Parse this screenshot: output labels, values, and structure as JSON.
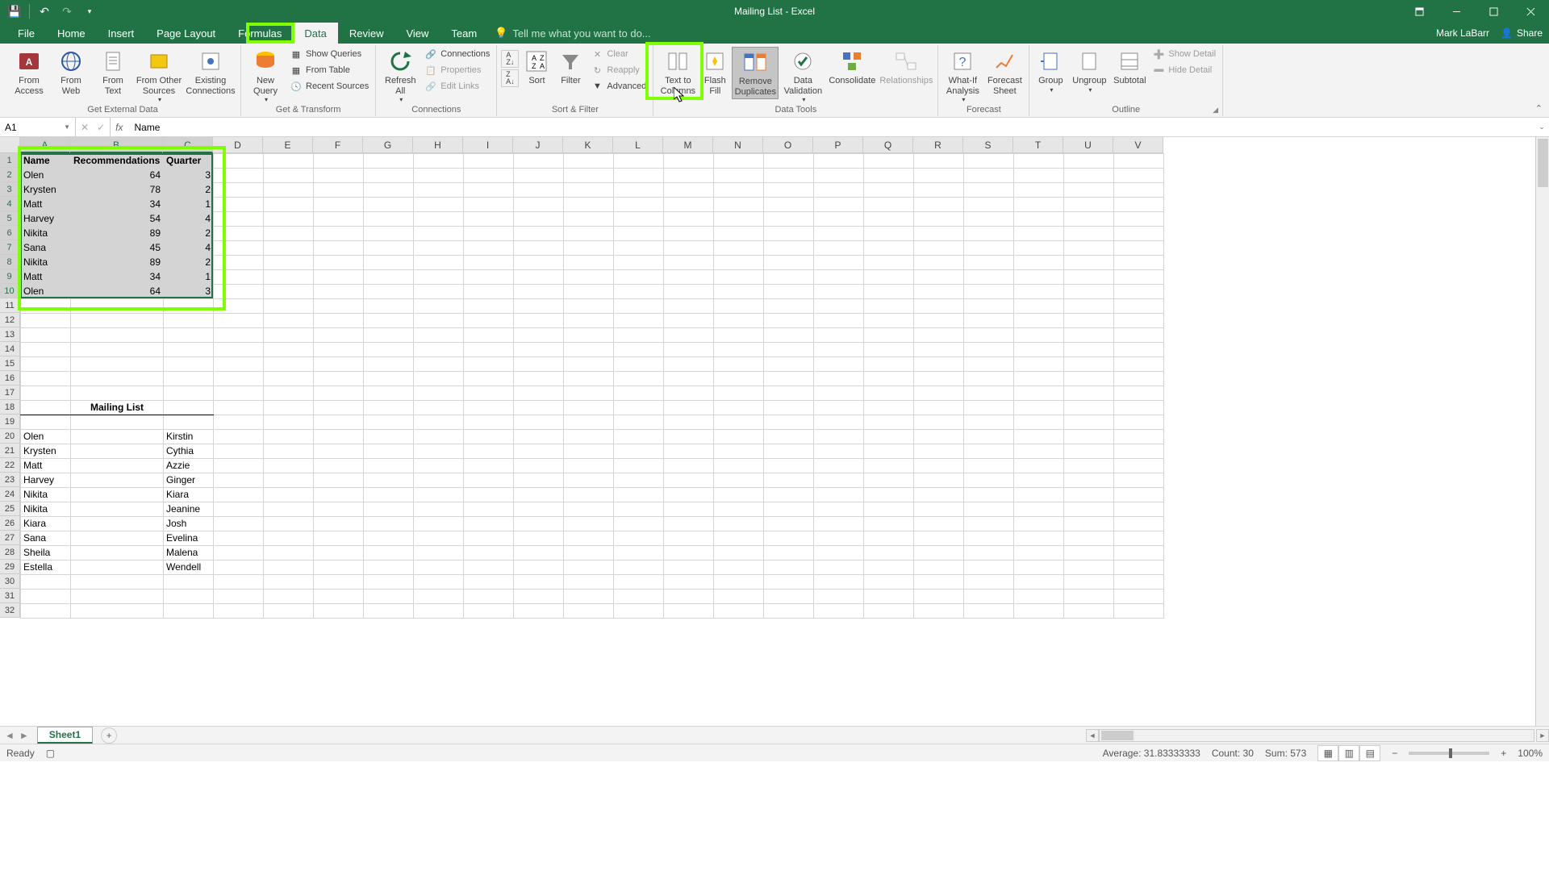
{
  "window": {
    "title": "Mailing List - Excel"
  },
  "user": {
    "name": "Mark LaBarr",
    "share": "Share"
  },
  "tabs": [
    "File",
    "Home",
    "Insert",
    "Page Layout",
    "Formulas",
    "Data",
    "Review",
    "View",
    "Team"
  ],
  "active_tab": "Data",
  "tellme": "Tell me what you want to do...",
  "ribbon": {
    "ext_data": {
      "label": "Get External Data",
      "buttons": [
        "From\nAccess",
        "From\nWeb",
        "From\nText",
        "From Other\nSources",
        "Existing\nConnections"
      ]
    },
    "get_transform": {
      "label": "Get & Transform",
      "new_query": "New\nQuery",
      "items": [
        "Show Queries",
        "From Table",
        "Recent Sources"
      ]
    },
    "connections": {
      "label": "Connections",
      "refresh": "Refresh\nAll",
      "items": [
        "Connections",
        "Properties",
        "Edit Links"
      ]
    },
    "sort_filter": {
      "label": "Sort & Filter",
      "sort": "Sort",
      "filter": "Filter",
      "items": [
        "Clear",
        "Reapply",
        "Advanced"
      ]
    },
    "data_tools": {
      "label": "Data Tools",
      "buttons": [
        "Text to\nColumns",
        "Flash\nFill",
        "Remove\nDuplicates",
        "Data\nValidation",
        "Consolidate",
        "Relationships"
      ]
    },
    "forecast": {
      "label": "Forecast",
      "buttons": [
        "What-If\nAnalysis",
        "Forecast\nSheet"
      ]
    },
    "outline": {
      "label": "Outline",
      "buttons": [
        "Group",
        "Ungroup",
        "Subtotal"
      ],
      "items": [
        "Show Detail",
        "Hide Detail"
      ]
    }
  },
  "name_box": "A1",
  "formula_value": "Name",
  "columns": [
    "A",
    "B",
    "C",
    "D",
    "E",
    "F",
    "G",
    "H",
    "I",
    "J",
    "K",
    "L",
    "M",
    "N",
    "O",
    "P",
    "Q",
    "R",
    "S",
    "T",
    "U",
    "V"
  ],
  "table": {
    "headers": [
      "Name",
      "Recommendations",
      "Quarter"
    ],
    "rows": [
      [
        "Olen",
        64,
        3
      ],
      [
        "Krysten",
        78,
        2
      ],
      [
        "Matt",
        34,
        1
      ],
      [
        "Harvey",
        54,
        4
      ],
      [
        "Nikita",
        89,
        2
      ],
      [
        "Sana",
        45,
        4
      ],
      [
        "Nikita",
        89,
        2
      ],
      [
        "Matt",
        34,
        1
      ],
      [
        "Olen",
        64,
        3
      ]
    ]
  },
  "mailing_list": {
    "title": "Mailing List",
    "colA": [
      "Olen",
      "Krysten",
      "Matt",
      "Harvey",
      "Nikita",
      "Nikita",
      "Kiara",
      "Sana",
      "Sheila",
      "Estella"
    ],
    "colC": [
      "Kirstin",
      "Cythia",
      "Azzie",
      "Ginger",
      "Kiara",
      "Jeanine",
      "Josh",
      "Evelina",
      "Malena",
      "Wendell"
    ]
  },
  "sheet_tab": "Sheet1",
  "status": {
    "ready": "Ready",
    "average": "Average: 31.83333333",
    "count": "Count: 30",
    "sum": "Sum: 573",
    "zoom": "100%"
  }
}
